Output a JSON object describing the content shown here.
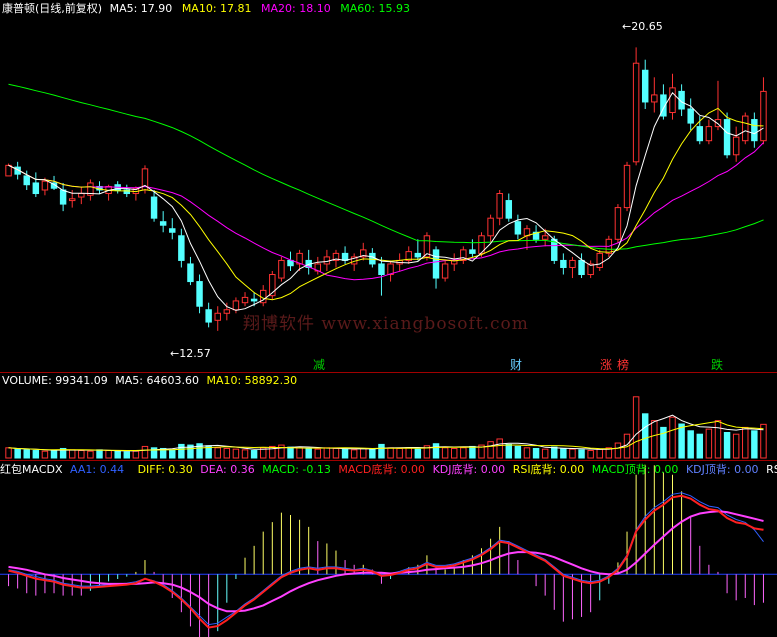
{
  "main_header": {
    "stock_title": "康普顿(日线,前复权)",
    "ma5": "MA5: 17.90",
    "ma10": "MA10: 17.81",
    "ma20": "MA20: 18.10",
    "ma60": "MA60: 15.93"
  },
  "price_annotations": {
    "high": "20.65",
    "low": "12.57"
  },
  "event_markers": [
    {
      "label": "减",
      "color": "#00cc00"
    },
    {
      "label": "财",
      "color": "#66ccff"
    },
    {
      "label": "涨",
      "color": "#ff3333"
    },
    {
      "label": "榜",
      "color": "#ff3333"
    },
    {
      "label": "跌",
      "color": "#00cc00"
    }
  ],
  "watermark": "翔博软件 www.xiangbosoft.com",
  "volume_header": {
    "volume": "VOLUME: 99341.09",
    "ma5": "MA5: 64603.60",
    "ma10": "MA10: 58892.30"
  },
  "indicator_header": {
    "name": "红包MACDX",
    "aa1": "AA1: 0.44",
    "diff": "DIFF: 0.30",
    "dea": "DEA: 0.36",
    "macd": "MACD: -0.13",
    "macd_bottom": "MACD底背: 0.00",
    "kdj_bottom": "KDJ底背: 0.00",
    "rsi_bottom": "RSI底背: 0.00",
    "macd_top": "MACD顶背: 0.00",
    "kdj_top": "KDJ顶背: 0.00",
    "rsi_trunc": "RSI"
  },
  "colors": {
    "background": "#000000",
    "up_candle": "#ff3232",
    "down_candle": "#54ffff",
    "ma5": "#ffffff",
    "ma10": "#ffff00",
    "ma20": "#ff00ff",
    "ma60": "#00ff00",
    "diff": "#ff2020",
    "dea": "#ff40ff",
    "aa1": "#3060ff"
  },
  "chart_data": {
    "type": "candlestick",
    "title": "康普顿(日线,前复权)",
    "ylim": [
      12.0,
      21.2
    ],
    "annotated_high": 20.65,
    "annotated_low": 12.57,
    "candles": [
      [
        17.0,
        17.35,
        17.1,
        17.3
      ],
      [
        17.25,
        17.4,
        16.9,
        17.05
      ],
      [
        17.0,
        17.15,
        16.6,
        16.75
      ],
      [
        16.8,
        17.1,
        16.4,
        16.5
      ],
      [
        16.6,
        16.95,
        16.45,
        16.85
      ],
      [
        16.8,
        17.0,
        16.6,
        16.65
      ],
      [
        16.6,
        16.8,
        16.0,
        16.2
      ],
      [
        16.3,
        16.6,
        16.1,
        16.35
      ],
      [
        16.4,
        16.7,
        16.2,
        16.5
      ],
      [
        16.45,
        16.9,
        16.3,
        16.8
      ],
      [
        16.7,
        16.85,
        16.5,
        16.6
      ],
      [
        16.5,
        16.75,
        16.3,
        16.7
      ],
      [
        16.75,
        16.85,
        16.5,
        16.6
      ],
      [
        16.6,
        16.75,
        16.4,
        16.5
      ],
      [
        16.5,
        16.7,
        16.3,
        16.65
      ],
      [
        16.6,
        17.3,
        16.5,
        17.2
      ],
      [
        16.4,
        16.6,
        15.7,
        15.8
      ],
      [
        15.7,
        16.0,
        15.4,
        15.6
      ],
      [
        15.5,
        15.8,
        15.2,
        15.4
      ],
      [
        15.3,
        15.5,
        14.4,
        14.6
      ],
      [
        14.5,
        14.7,
        13.9,
        14.0
      ],
      [
        14.0,
        14.2,
        13.1,
        13.3
      ],
      [
        13.2,
        13.4,
        12.7,
        12.85
      ],
      [
        12.9,
        13.3,
        12.6,
        13.1
      ],
      [
        13.1,
        13.4,
        12.9,
        13.2
      ],
      [
        13.2,
        13.55,
        13.1,
        13.45
      ],
      [
        13.4,
        13.7,
        13.3,
        13.55
      ],
      [
        13.5,
        13.7,
        13.3,
        13.45
      ],
      [
        13.4,
        13.9,
        13.3,
        13.75
      ],
      [
        13.6,
        14.3,
        13.5,
        14.2
      ],
      [
        14.1,
        14.7,
        14.0,
        14.6
      ],
      [
        14.6,
        14.85,
        14.3,
        14.45
      ],
      [
        14.5,
        14.9,
        14.3,
        14.8
      ],
      [
        14.6,
        14.9,
        14.2,
        14.4
      ],
      [
        14.3,
        14.7,
        14.2,
        14.5
      ],
      [
        14.5,
        14.9,
        14.3,
        14.7
      ],
      [
        14.6,
        14.9,
        14.4,
        14.8
      ],
      [
        14.8,
        15.0,
        14.5,
        14.6
      ],
      [
        14.5,
        14.8,
        14.3,
        14.7
      ],
      [
        14.7,
        15.1,
        14.6,
        14.9
      ],
      [
        14.8,
        14.95,
        14.4,
        14.5
      ],
      [
        14.5,
        14.7,
        13.6,
        14.2
      ],
      [
        14.2,
        14.6,
        14.0,
        14.5
      ],
      [
        14.5,
        14.8,
        14.3,
        14.6
      ],
      [
        14.6,
        15.0,
        14.5,
        14.85
      ],
      [
        14.8,
        15.2,
        14.6,
        14.7
      ],
      [
        14.7,
        15.4,
        14.6,
        15.3
      ],
      [
        14.9,
        15.0,
        13.8,
        14.1
      ],
      [
        14.1,
        14.6,
        14.0,
        14.5
      ],
      [
        14.5,
        14.8,
        14.3,
        14.6
      ],
      [
        14.6,
        15.0,
        14.5,
        14.9
      ],
      [
        14.9,
        15.2,
        14.7,
        14.8
      ],
      [
        14.8,
        15.4,
        14.7,
        15.3
      ],
      [
        15.3,
        15.9,
        15.1,
        15.8
      ],
      [
        15.8,
        16.6,
        15.6,
        16.5
      ],
      [
        16.3,
        16.5,
        15.7,
        15.8
      ],
      [
        15.7,
        15.9,
        15.2,
        15.35
      ],
      [
        15.3,
        15.6,
        14.9,
        15.5
      ],
      [
        15.4,
        15.6,
        15.1,
        15.2
      ],
      [
        15.2,
        15.5,
        15.0,
        15.3
      ],
      [
        15.2,
        15.3,
        14.5,
        14.6
      ],
      [
        14.6,
        14.8,
        14.2,
        14.4
      ],
      [
        14.4,
        14.7,
        14.1,
        14.6
      ],
      [
        14.6,
        14.8,
        14.1,
        14.2
      ],
      [
        14.2,
        14.6,
        14.1,
        14.5
      ],
      [
        14.4,
        14.9,
        14.3,
        14.8
      ],
      [
        14.8,
        15.3,
        14.7,
        15.2
      ],
      [
        15.2,
        16.2,
        15.1,
        16.1
      ],
      [
        16.1,
        17.4,
        16.0,
        17.3
      ],
      [
        17.4,
        20.65,
        17.3,
        20.2
      ],
      [
        20.0,
        20.3,
        18.9,
        19.1
      ],
      [
        19.1,
        19.8,
        18.8,
        19.3
      ],
      [
        19.3,
        19.6,
        18.6,
        18.7
      ],
      [
        18.8,
        19.9,
        18.6,
        19.5
      ],
      [
        19.4,
        19.6,
        18.7,
        18.9
      ],
      [
        18.9,
        19.2,
        18.3,
        18.5
      ],
      [
        18.4,
        18.7,
        17.9,
        18.0
      ],
      [
        18.0,
        18.6,
        17.9,
        18.4
      ],
      [
        18.4,
        19.7,
        18.3,
        18.6
      ],
      [
        18.6,
        18.8,
        17.5,
        17.6
      ],
      [
        17.6,
        18.4,
        17.4,
        18.1
      ],
      [
        18.0,
        18.8,
        17.9,
        18.7
      ],
      [
        18.6,
        18.8,
        17.8,
        18.0
      ],
      [
        18.0,
        19.8,
        17.9,
        19.4
      ]
    ],
    "volume": [
      30,
      26,
      24,
      22,
      20,
      22,
      28,
      24,
      22,
      20,
      24,
      22,
      20,
      18,
      20,
      34,
      30,
      28,
      24,
      40,
      38,
      42,
      36,
      30,
      28,
      26,
      24,
      22,
      30,
      34,
      38,
      32,
      30,
      28,
      26,
      30,
      28,
      26,
      24,
      28,
      26,
      40,
      30,
      28,
      30,
      26,
      36,
      42,
      30,
      28,
      30,
      34,
      38,
      48,
      56,
      40,
      34,
      30,
      28,
      26,
      32,
      28,
      26,
      24,
      22,
      26,
      30,
      44,
      70,
      180,
      130,
      110,
      90,
      120,
      100,
      80,
      70,
      85,
      110,
      75,
      70,
      90,
      80,
      99
    ],
    "volume_ylim": [
      0,
      200
    ],
    "indicator": {
      "diff": [
        0.05,
        0.02,
        -0.02,
        -0.06,
        -0.08,
        -0.1,
        -0.14,
        -0.16,
        -0.18,
        -0.18,
        -0.17,
        -0.16,
        -0.15,
        -0.14,
        -0.12,
        -0.06,
        -0.1,
        -0.16,
        -0.24,
        -0.34,
        -0.46,
        -0.6,
        -0.72,
        -0.7,
        -0.62,
        -0.52,
        -0.42,
        -0.34,
        -0.24,
        -0.14,
        -0.04,
        0.02,
        0.06,
        0.08,
        0.06,
        0.08,
        0.08,
        0.06,
        0.05,
        0.06,
        0.04,
        -0.02,
        -0.01,
        0.02,
        0.06,
        0.08,
        0.14,
        0.1,
        0.1,
        0.12,
        0.16,
        0.2,
        0.26,
        0.34,
        0.44,
        0.42,
        0.36,
        0.3,
        0.24,
        0.18,
        0.08,
        -0.02,
        -0.06,
        -0.1,
        -0.12,
        -0.1,
        -0.04,
        0.06,
        0.24,
        0.58,
        0.74,
        0.86,
        0.94,
        1.04,
        1.06,
        1.02,
        0.94,
        0.88,
        0.86,
        0.76,
        0.7,
        0.68,
        0.62,
        0.6
      ],
      "dea": [
        0.1,
        0.08,
        0.06,
        0.03,
        0.0,
        -0.02,
        -0.05,
        -0.07,
        -0.09,
        -0.11,
        -0.12,
        -0.13,
        -0.13,
        -0.13,
        -0.13,
        -0.12,
        -0.11,
        -0.12,
        -0.14,
        -0.18,
        -0.24,
        -0.31,
        -0.4,
        -0.46,
        -0.5,
        -0.5,
        -0.49,
        -0.46,
        -0.42,
        -0.36,
        -0.3,
        -0.23,
        -0.17,
        -0.12,
        -0.08,
        -0.05,
        -0.02,
        0.0,
        0.01,
        0.02,
        0.02,
        0.02,
        0.01,
        0.02,
        0.03,
        0.04,
        0.06,
        0.07,
        0.08,
        0.09,
        0.1,
        0.12,
        0.15,
        0.19,
        0.24,
        0.28,
        0.3,
        0.3,
        0.29,
        0.27,
        0.23,
        0.18,
        0.13,
        0.08,
        0.04,
        0.01,
        0.0,
        0.01,
        0.06,
        0.16,
        0.28,
        0.4,
        0.51,
        0.62,
        0.71,
        0.78,
        0.82,
        0.84,
        0.85,
        0.84,
        0.81,
        0.78,
        0.75,
        0.72
      ],
      "aa1": [
        0.06,
        0.04,
        0.0,
        -0.03,
        -0.06,
        -0.08,
        -0.12,
        -0.14,
        -0.16,
        -0.16,
        -0.15,
        -0.14,
        -0.13,
        -0.12,
        -0.1,
        -0.06,
        -0.09,
        -0.14,
        -0.22,
        -0.32,
        -0.44,
        -0.56,
        -0.68,
        -0.66,
        -0.58,
        -0.5,
        -0.4,
        -0.32,
        -0.22,
        -0.12,
        -0.02,
        0.04,
        0.08,
        0.1,
        0.08,
        0.1,
        0.1,
        0.08,
        0.06,
        0.08,
        0.05,
        0.0,
        0.01,
        0.04,
        0.08,
        0.1,
        0.16,
        0.12,
        0.12,
        0.14,
        0.18,
        0.22,
        0.28,
        0.36,
        0.46,
        0.44,
        0.38,
        0.32,
        0.26,
        0.2,
        0.1,
        0.0,
        -0.04,
        -0.08,
        -0.1,
        -0.08,
        -0.02,
        0.08,
        0.26,
        0.6,
        0.78,
        0.9,
        0.98,
        1.08,
        1.1,
        1.06,
        0.98,
        0.92,
        0.9,
        0.8,
        0.74,
        0.7,
        0.6,
        0.44
      ],
      "ylim": [
        -0.82,
        1.3
      ],
      "current": {
        "aa1": 0.44,
        "diff": 0.3,
        "dea": 0.36,
        "macd": -0.13
      }
    }
  }
}
